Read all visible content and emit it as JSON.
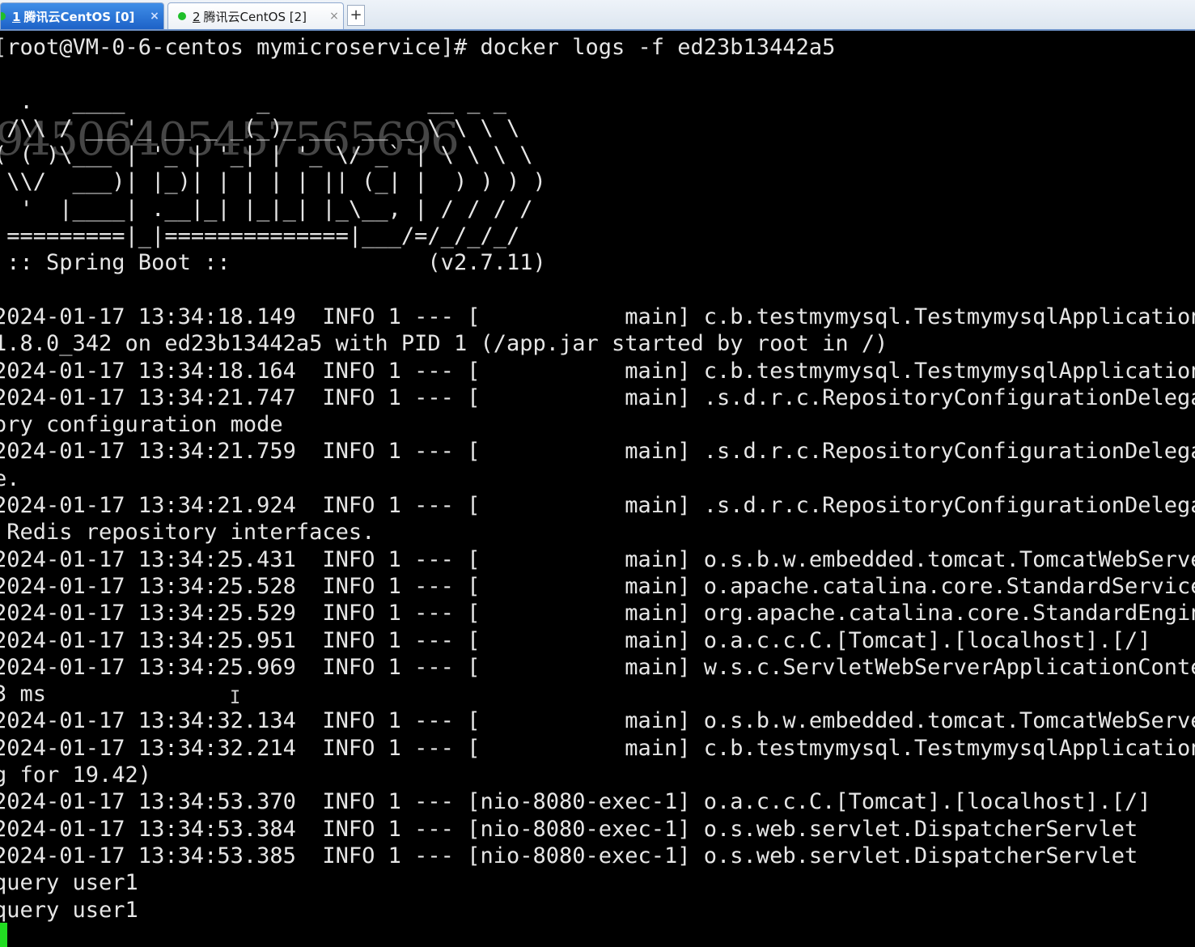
{
  "tabs": [
    {
      "index": "1",
      "title": "腾讯云CentOS [0]",
      "close": "×",
      "active": true
    },
    {
      "index": "2",
      "title": "腾讯云CentOS [2]",
      "close": "×",
      "active": false
    }
  ],
  "new_tab_label": "+",
  "watermark": "94506405457565696",
  "terminal_lines": [
    "[root@VM-0-6-centos mymicroservice]# docker logs -f ed23b13442a5",
    "",
    "  .   ____          _            __ _ _",
    " /\\\\ / ___'_ __ _ _(_)_ __  __ _ \\ \\ \\ \\",
    "( ( )\\___ | '_ | '_| | '_ \\/ _` | \\ \\ \\ \\",
    " \\\\/  ___)| |_)| | | | | || (_| |  ) ) ) )",
    "  '  |____| .__|_| |_|_| |_\\__, | / / / /",
    " =========|_|==============|___/=/_/_/_/",
    " :: Spring Boot ::               (v2.7.11)",
    "",
    "2024-01-17 13:34:18.149  INFO 1 --- [           main] c.b.testmymysql.TestmymysqlApplication",
    "1.8.0_342 on ed23b13442a5 with PID 1 (/app.jar started by root in /)",
    "2024-01-17 13:34:18.164  INFO 1 --- [           main] c.b.testmymysql.TestmymysqlApplication",
    "2024-01-17 13:34:21.747  INFO 1 --- [           main] .s.d.r.c.RepositoryConfigurationDelegat",
    "ory configuration mode",
    "2024-01-17 13:34:21.759  INFO 1 --- [           main] .s.d.r.c.RepositoryConfigurationDelegat",
    "e.",
    "2024-01-17 13:34:21.924  INFO 1 --- [           main] .s.d.r.c.RepositoryConfigurationDelegat",
    " Redis repository interfaces.",
    "2024-01-17 13:34:25.431  INFO 1 --- [           main] o.s.b.w.embedded.tomcat.TomcatWebServer",
    "2024-01-17 13:34:25.528  INFO 1 --- [           main] o.apache.catalina.core.StandardService",
    "2024-01-17 13:34:25.529  INFO 1 --- [           main] org.apache.catalina.core.StandardEngine",
    "2024-01-17 13:34:25.951  INFO 1 --- [           main] o.a.c.c.C.[Tomcat].[localhost].[/]",
    "2024-01-17 13:34:25.969  INFO 1 --- [           main] w.s.c.ServletWebServerApplicationContex",
    "3 ms",
    "2024-01-17 13:34:32.134  INFO 1 --- [           main] o.s.b.w.embedded.tomcat.TomcatWebServer",
    "2024-01-17 13:34:32.214  INFO 1 --- [           main] c.b.testmymysql.TestmymysqlApplication",
    "g for 19.42)",
    "2024-01-17 13:34:53.370  INFO 1 --- [nio-8080-exec-1] o.a.c.c.C.[Tomcat].[localhost].[/]",
    "2024-01-17 13:34:53.384  INFO 1 --- [nio-8080-exec-1] o.s.web.servlet.DispatcherServlet",
    "2024-01-17 13:34:53.385  INFO 1 --- [nio-8080-exec-1] o.s.web.servlet.DispatcherServlet",
    "query user1",
    "query user1"
  ],
  "colors": {
    "terminal_bg": "#000000",
    "terminal_fg": "#e6e6e6",
    "active_tab": "#1d62c7",
    "status_green": "#1fbf2a",
    "cursor_green": "#22dd22"
  }
}
